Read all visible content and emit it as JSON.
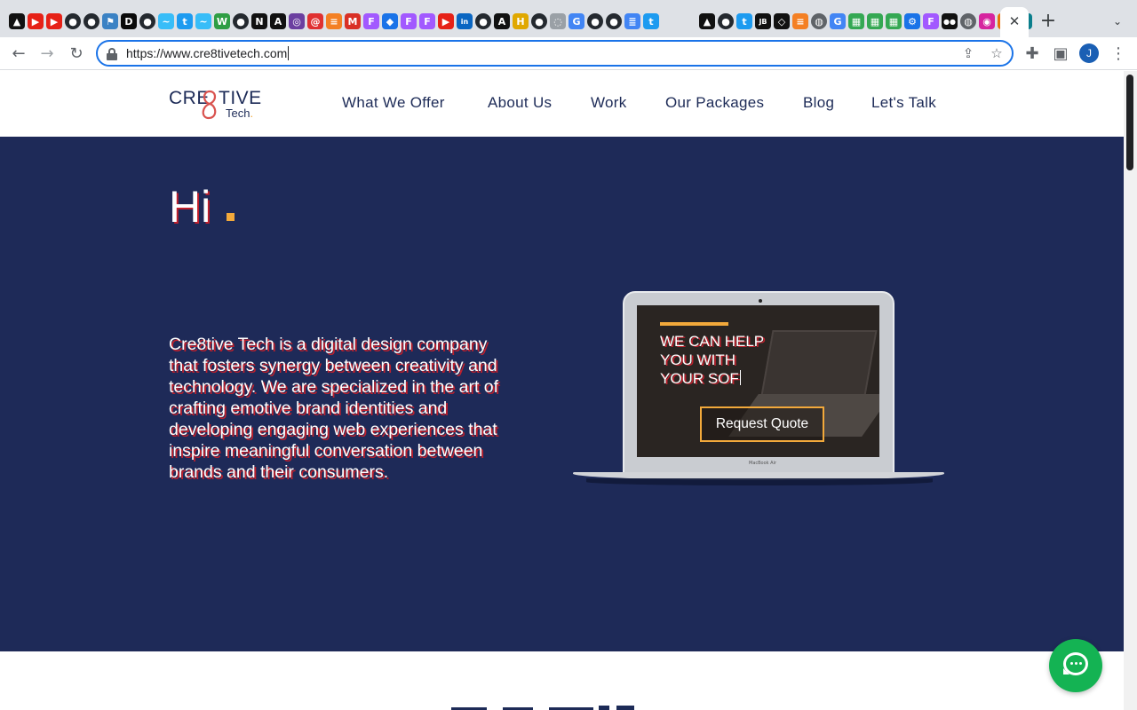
{
  "browser": {
    "tabs": [
      {
        "icon": "vercel-icon",
        "glyph": "▲",
        "color": "#111111"
      },
      {
        "icon": "youtube-icon",
        "glyph": "▶",
        "color": "#e62117"
      },
      {
        "icon": "youtube-icon",
        "glyph": "▶",
        "color": "#e62117"
      },
      {
        "icon": "github-icon",
        "glyph": "●",
        "color": "#24292f"
      },
      {
        "icon": "github-icon",
        "glyph": "●",
        "color": "#24292f"
      },
      {
        "icon": "flag-icon",
        "glyph": "⚑",
        "color": "#3b82c4"
      },
      {
        "icon": "dev-icon",
        "glyph": "D",
        "color": "#0a0a0a"
      },
      {
        "icon": "github-icon",
        "glyph": "●",
        "color": "#24292f"
      },
      {
        "icon": "tailwind-icon",
        "glyph": "~",
        "color": "#38bdf8"
      },
      {
        "icon": "twitter-icon",
        "glyph": "t",
        "color": "#1d9bf0"
      },
      {
        "icon": "tailwind-icon",
        "glyph": "~",
        "color": "#38bdf8"
      },
      {
        "icon": "webflow-icon",
        "glyph": "W",
        "color": "#2f9e44"
      },
      {
        "icon": "github-icon",
        "glyph": "●",
        "color": "#24292f"
      },
      {
        "icon": "notion-icon",
        "glyph": "N",
        "color": "#111111"
      },
      {
        "icon": "app-icon",
        "glyph": "A",
        "color": "#111111"
      },
      {
        "icon": "circle-app-icon",
        "glyph": "◎",
        "color": "#6b3fa0"
      },
      {
        "icon": "email-app-icon",
        "glyph": "@",
        "color": "#e03131"
      },
      {
        "icon": "stackoverflow-icon",
        "glyph": "≡",
        "color": "#f48024"
      },
      {
        "icon": "gmail-icon",
        "glyph": "M",
        "color": "#d93025"
      },
      {
        "icon": "figma-icon",
        "glyph": "F",
        "color": "#a259ff"
      },
      {
        "icon": "diamond-app-icon",
        "glyph": "◆",
        "color": "#1a73e8"
      },
      {
        "icon": "figma-icon",
        "glyph": "F",
        "color": "#a259ff"
      },
      {
        "icon": "figma-icon",
        "glyph": "F",
        "color": "#a259ff"
      },
      {
        "icon": "youtube-icon",
        "glyph": "▶",
        "color": "#e62117"
      },
      {
        "icon": "linkedin-icon",
        "glyph": "in",
        "color": "#0a66c2"
      },
      {
        "icon": "github-icon",
        "glyph": "●",
        "color": "#24292f"
      },
      {
        "icon": "app-icon",
        "glyph": "A",
        "color": "#111111"
      },
      {
        "icon": "hashnode-icon",
        "glyph": "H",
        "color": "#e0a800"
      },
      {
        "icon": "github-icon",
        "glyph": "●",
        "color": "#24292f"
      },
      {
        "icon": "generic-page-icon",
        "glyph": "◌",
        "color": "#9aa0a6"
      },
      {
        "icon": "google-icon",
        "glyph": "G",
        "color": "#4285f4"
      },
      {
        "icon": "github-icon",
        "glyph": "●",
        "color": "#24292f"
      },
      {
        "icon": "github-icon",
        "glyph": "●",
        "color": "#24292f"
      },
      {
        "icon": "docs-icon",
        "glyph": "≣",
        "color": "#4285f4"
      },
      {
        "icon": "twitter-icon",
        "glyph": "t",
        "color": "#1d9bf0"
      },
      {
        "icon": "vercel-icon",
        "glyph": "▲",
        "color": "#111111"
      },
      {
        "icon": "github-icon",
        "glyph": "●",
        "color": "#24292f"
      },
      {
        "icon": "twitter-icon",
        "glyph": "t",
        "color": "#1d9bf0"
      },
      {
        "icon": "jetbrains-icon",
        "glyph": "JB",
        "color": "#111111"
      },
      {
        "icon": "codepen-icon",
        "glyph": "◇",
        "color": "#111111"
      },
      {
        "icon": "stackoverflow-icon",
        "glyph": "≡",
        "color": "#f48024"
      },
      {
        "icon": "globe-icon",
        "glyph": "◍",
        "color": "#5f6368"
      },
      {
        "icon": "google-icon",
        "glyph": "G",
        "color": "#4285f4"
      },
      {
        "icon": "sheets-icon",
        "glyph": "▦",
        "color": "#34a853"
      },
      {
        "icon": "sheets-icon",
        "glyph": "▦",
        "color": "#34a853"
      },
      {
        "icon": "sheets-icon",
        "glyph": "▦",
        "color": "#34a853"
      },
      {
        "icon": "settings-icon",
        "glyph": "⚙",
        "color": "#1a73e8"
      },
      {
        "icon": "figma-icon",
        "glyph": "F",
        "color": "#a259ff"
      },
      {
        "icon": "medium-icon",
        "glyph": "●●",
        "color": "#111111"
      },
      {
        "icon": "globe-icon",
        "glyph": "◍",
        "color": "#5f6368"
      },
      {
        "icon": "instagram-icon",
        "glyph": "◉",
        "color": "#d6249f"
      },
      {
        "icon": "app-grid-icon",
        "glyph": "▚",
        "color": "#e8710a"
      },
      {
        "icon": "react-icon",
        "glyph": "⚛",
        "color": "#0a7e8c"
      }
    ],
    "close_glyph": "✕",
    "new_tab_glyph": "+",
    "tab_menu_glyph": "⌄",
    "url": "https://www.cre8tivetech.com",
    "avatar_initial": "J",
    "accent_color": "#1a73e8"
  },
  "site": {
    "logo": {
      "part1": "CRE",
      "part2": "TIVE",
      "part3": "Tech",
      "dot": ".",
      "figure": "8",
      "color": "#1d2b57",
      "accent": "#d9534f"
    },
    "nav": [
      "What We Offer",
      "About Us",
      "Work",
      "Our Packages",
      "Blog",
      "Let's Talk"
    ],
    "hero": {
      "heading": "Hi",
      "description": "Cre8tive Tech is a digital design company that fosters synergy between creativity and technology. We are specialized in the art of crafting emotive brand identities and developing engaging web experiences that inspire meaningful conversation between brands and their consumers.",
      "typing_line1": "WE CAN HELP",
      "typing_line2": "YOU WITH",
      "typing_line3": "YOUR SOF",
      "cta": "Request Quote",
      "laptop_label": "MacBook Air",
      "bg_color": "#1e2a58",
      "accent_color": "#f2a93b",
      "shadow_color": "#c0202c"
    },
    "chat": {
      "icon": "chat-icon",
      "color": "#14b353"
    }
  }
}
